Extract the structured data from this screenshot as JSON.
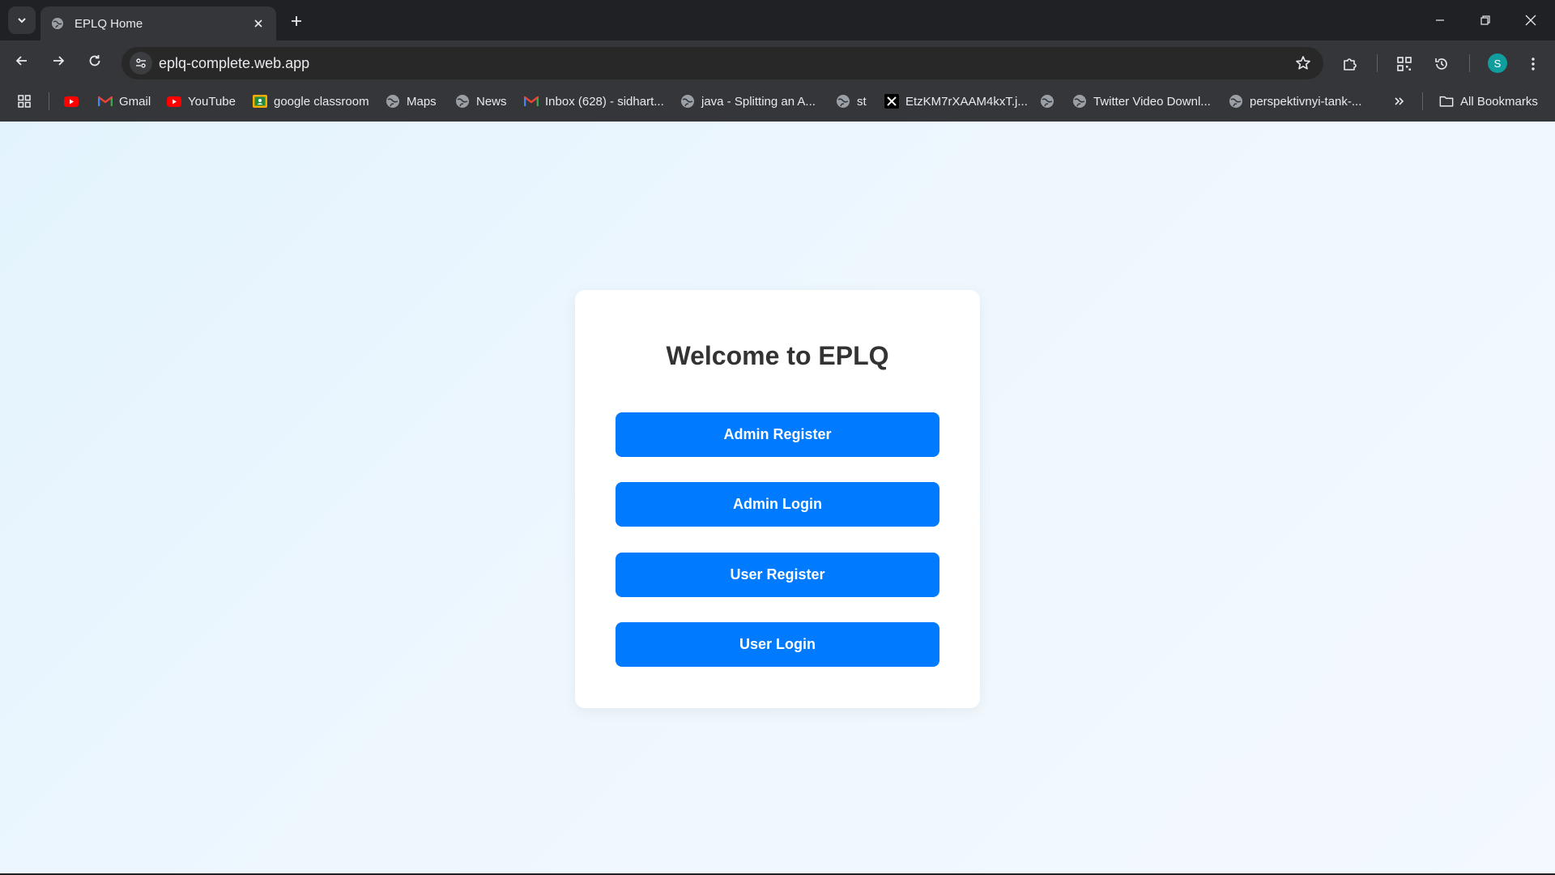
{
  "browser": {
    "tab": {
      "title": "EPLQ Home"
    },
    "url": "eplq-complete.web.app",
    "profile_initial": "S",
    "bookmarks": [
      {
        "label": "",
        "icon": "youtube-icon"
      },
      {
        "label": "Gmail",
        "icon": "gmail-icon"
      },
      {
        "label": "YouTube",
        "icon": "youtube-icon"
      },
      {
        "label": "google classroom",
        "icon": "classroom-icon"
      },
      {
        "label": "Maps",
        "icon": "globe-icon"
      },
      {
        "label": "News",
        "icon": "globe-icon"
      },
      {
        "label": "Inbox (628) - sidhart...",
        "icon": "gmail-icon"
      },
      {
        "label": "java - Splitting an A...",
        "icon": "globe-icon"
      },
      {
        "label": "st",
        "icon": "globe-icon"
      },
      {
        "label": "EtzKM7rXAAM4kxT.j...",
        "icon": "x-icon"
      },
      {
        "label": "",
        "icon": "globe-icon"
      },
      {
        "label": "Twitter Video Downl...",
        "icon": "globe-icon"
      },
      {
        "label": "perspektivnyi-tank-...",
        "icon": "globe-icon"
      }
    ],
    "all_bookmarks_label": "All Bookmarks"
  },
  "page": {
    "title": "Welcome to EPLQ",
    "buttons": {
      "admin_register": "Admin Register",
      "admin_login": "Admin Login",
      "user_register": "User Register",
      "user_login": "User Login"
    }
  },
  "colors": {
    "primary_button": "#007bff",
    "page_background": "#eaf5fd",
    "avatar": "#0f9d9d"
  }
}
